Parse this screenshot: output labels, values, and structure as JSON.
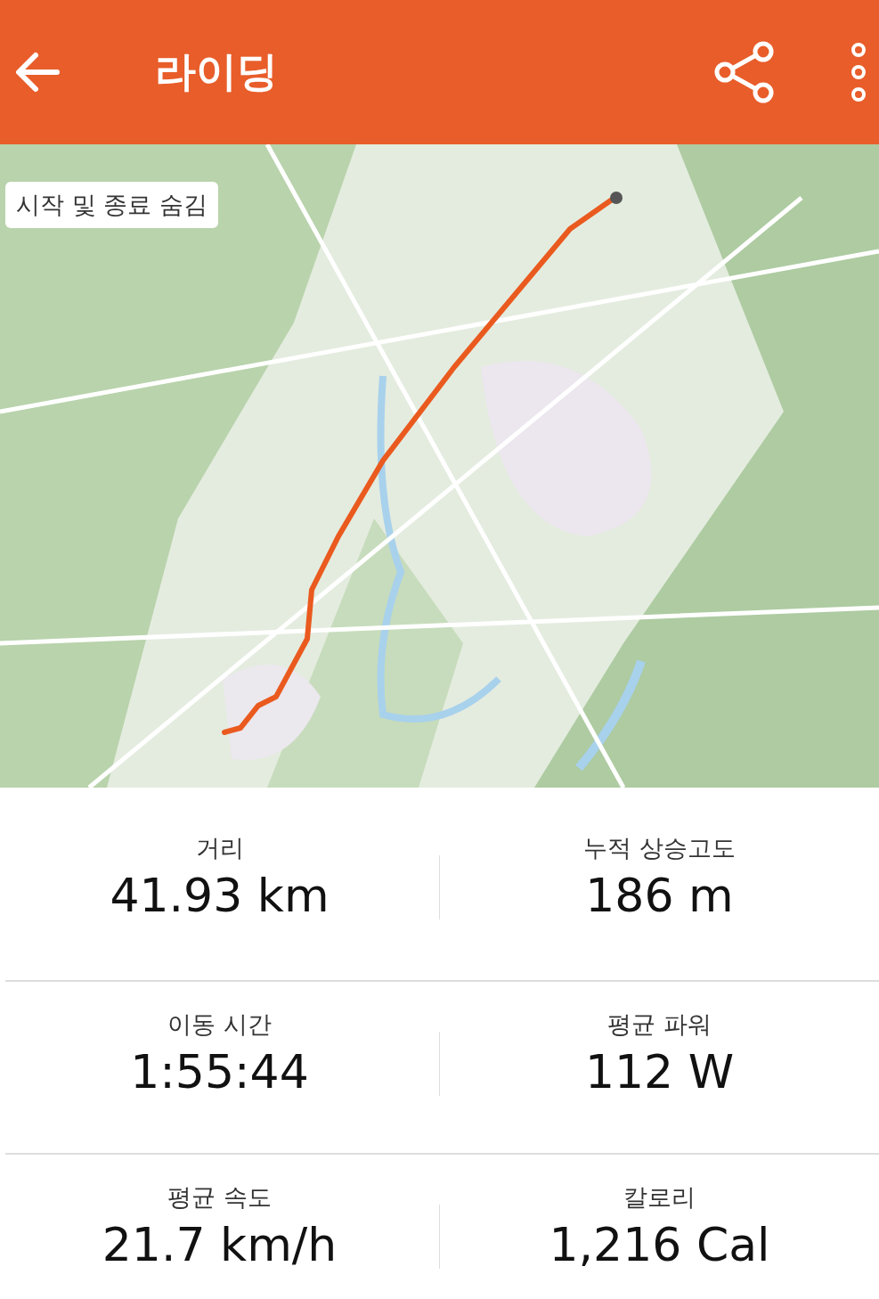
{
  "header": {
    "title": "라이딩"
  },
  "map": {
    "toggle_button": "시작 및 종료 숨김"
  },
  "stats": [
    [
      {
        "label": "거리",
        "value": "41.93 km"
      },
      {
        "label": "누적 상승고도",
        "value": "186 m"
      }
    ],
    [
      {
        "label": "이동 시간",
        "value": "1:55:44"
      },
      {
        "label": "평균 파워",
        "value": "112 W"
      }
    ],
    [
      {
        "label": "평균 속도",
        "value": "21.7 km/h"
      },
      {
        "label": "칼로리",
        "value": "1,216 Cal"
      }
    ]
  ]
}
